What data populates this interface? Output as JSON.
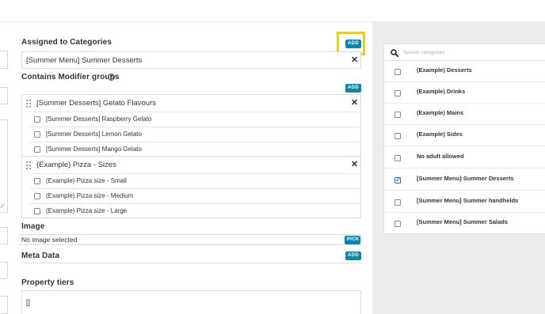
{
  "left_form": {
    "assigned_categories": {
      "label": "Assigned to Categories",
      "add_label": "ADD",
      "value": "[Summer Menu] Summer Desserts"
    },
    "modifier_groups": {
      "label": "Contains Modifier groups",
      "add_label": "ADD",
      "groups": [
        {
          "title": "[Summer Desserts] Gelato Flavours",
          "items": [
            "[Summer Desserts] Raspberry Gelato",
            "[Summer Desserts] Lemon Gelato",
            "[Summer Desserts] Mango Gelato"
          ]
        },
        {
          "title": "(Example) Pizza - Sizes",
          "items": [
            "(Example) Pizza size - Small",
            "(Example) Pizza size - Medium",
            "(Example) Pizza size - Large"
          ]
        }
      ]
    },
    "image": {
      "label": "Image",
      "value": "No image selected",
      "pick_label": "PICK"
    },
    "meta_data": {
      "label": "Meta Data",
      "add_label": "ADD"
    },
    "property_tiers": {
      "label": "Property tiers",
      "value": "[]"
    }
  },
  "category_panel": {
    "search_placeholder": "Search categories",
    "items": [
      {
        "label": "(Example) Desserts",
        "checked": false
      },
      {
        "label": "(Example) Drinks",
        "checked": false
      },
      {
        "label": "(Example) Mains",
        "checked": false
      },
      {
        "label": "(Example) Sides",
        "checked": false
      },
      {
        "label": "No adult allowed",
        "checked": false
      },
      {
        "label": "[Summer Menu] Summer Desserts",
        "checked": true
      },
      {
        "label": "[Summer Menu] Summer handhelds",
        "checked": false
      },
      {
        "label": "[Summer Menu] Summer Salads",
        "checked": false
      }
    ]
  },
  "colors": {
    "accent": "#0b86a8",
    "highlight": "#f2cf16",
    "panel_bg": "#ececec"
  }
}
